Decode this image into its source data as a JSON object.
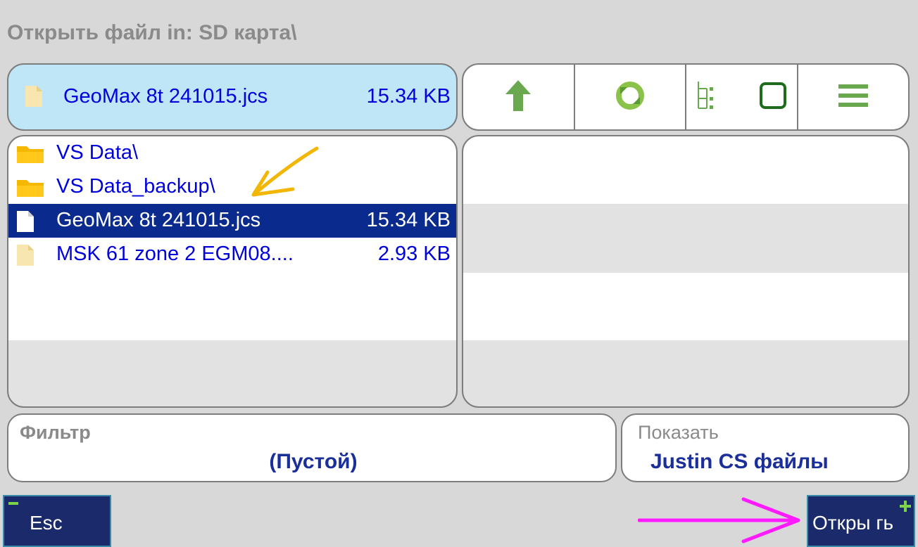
{
  "window": {
    "title": "Открыть файл in: SD карта\\"
  },
  "selected_file": {
    "name": "GeoMax 8t 241015.jcs",
    "size": "15.34 KB",
    "icon": "file-icon"
  },
  "toolbar": {
    "buttons": [
      {
        "icon": "up-arrow-icon"
      },
      {
        "icon": "refresh-icon"
      },
      {
        "icon": "tree-view-icon"
      },
      {
        "icon": "menu-icon"
      }
    ]
  },
  "files": [
    {
      "name": "VS Data\\",
      "size": "",
      "type": "folder"
    },
    {
      "name": "VS Data_backup\\",
      "size": "",
      "type": "folder"
    },
    {
      "name": "GeoMax 8t 241015.jcs",
      "size": "15.34 KB",
      "type": "file",
      "selected": true
    },
    {
      "name": "MSK 61 zone 2 EGM08....",
      "size": "2.93 KB",
      "type": "file"
    }
  ],
  "filter": {
    "label": "Фильтр",
    "value": "(Пустой)"
  },
  "show": {
    "label": "Показать",
    "value": "Justin CS файлы"
  },
  "softkeys": {
    "esc": "Esc",
    "open": "Откры гь"
  },
  "colors": {
    "background": "#d8d8d8",
    "selected_panel": "#bfe6f6",
    "selection": "#0a2a8e",
    "link_text": "#0000dd",
    "icon_green": "#6aa84f",
    "annotation_arrow_yellow": "#f2b705",
    "annotation_arrow_magenta": "#ff1aff"
  }
}
